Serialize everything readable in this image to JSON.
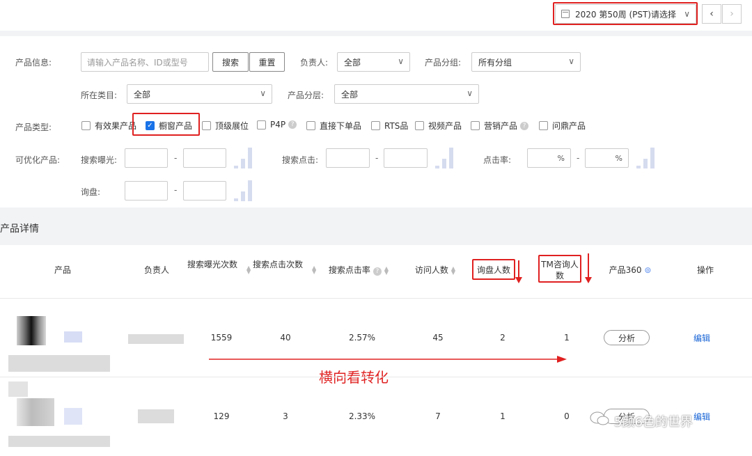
{
  "header": {
    "week_label": "2020 第50周 (PST)请选择",
    "prev_icon": "chevron-left-icon",
    "next_icon": "chevron-right-icon"
  },
  "filters": {
    "product_info_label": "产品信息:",
    "product_search_placeholder": "请输入产品名称、ID或型号",
    "search_button": "搜索",
    "reset_button": "重置",
    "owner_label": "负责人:",
    "owner_value": "全部",
    "group_label": "产品分组:",
    "group_value": "所有分组",
    "category_label": "所在类目:",
    "category_value": "全部",
    "tier_label": "产品分层:",
    "tier_value": "全部",
    "type_label": "产品类型:",
    "types": [
      {
        "label": "有效果产品",
        "checked": false
      },
      {
        "label": "橱窗产品",
        "checked": true
      },
      {
        "label": "顶级展位",
        "checked": false
      },
      {
        "label": "P4P",
        "checked": false
      },
      {
        "label": "直接下单品",
        "checked": false
      },
      {
        "label": "RTS品",
        "checked": false
      },
      {
        "label": "视频产品",
        "checked": false
      },
      {
        "label": "营销产品",
        "checked": false
      },
      {
        "label": "问鼎产品",
        "checked": false
      }
    ],
    "optimizable_label": "可优化产品:",
    "search_exposure_label": "搜索曝光:",
    "search_click_label": "搜索点击:",
    "ctr_label": "点击率:",
    "inquiry_label": "询盘:",
    "percent_unit": "%",
    "range_dash": "-"
  },
  "section": {
    "title": "产品详情"
  },
  "table": {
    "headers": {
      "product": "产品",
      "owner": "负责人",
      "search_exposure": "搜索曝光次数",
      "search_clicks": "搜索点击次数",
      "search_ctr": "搜索点击率",
      "visitors": "访问人数",
      "inquiries": "询盘人数",
      "tm_consult": "TM咨询人数",
      "product360": "产品360",
      "actions": "操作"
    },
    "rows": [
      {
        "search_exposure": "1559",
        "search_clicks": "40",
        "search_ctr": "2.57%",
        "visitors": "45",
        "inquiries": "2",
        "tm_consult": "1",
        "analyze": "分析",
        "edit": "编辑"
      },
      {
        "search_exposure": "129",
        "search_clicks": "3",
        "search_ctr": "2.33%",
        "visitors": "7",
        "inquiries": "1",
        "tm_consult": "0",
        "analyze": "分析",
        "edit": "编辑"
      }
    ]
  },
  "annotation": {
    "text": "横向看转化",
    "color": "#e02020"
  },
  "watermark": {
    "text": "5颜6色的世界"
  }
}
